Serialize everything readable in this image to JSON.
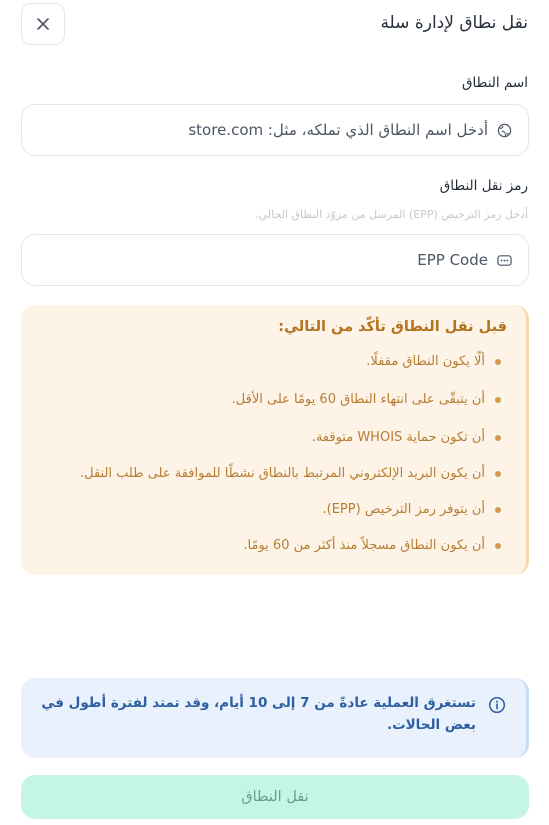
{
  "header": {
    "title": "نقل نطاق لإدارة سلة",
    "close_icon": "close-icon"
  },
  "domain_field": {
    "label": "اسم النطاق",
    "placeholder": "أدخل اسم النطاق الذي تملكه، مثل: store.com",
    "icon": "globe-icon"
  },
  "epp_field": {
    "label": "رمز نقل النطاق",
    "hint": "أدخل رمز الترخيص (EPP) المرسل من مزوّد النطاق الحالي.",
    "placeholder": "EPP Code",
    "icon": "password-dots-icon"
  },
  "requirements": {
    "title": "قبل نقل النطاق تأكّد من التالي:",
    "items": [
      "ألّا يكون النطاق مقفلًا.",
      "أن يتبقّى على انتهاء النطاق 60 يومًا على الأقل.",
      "أن تكون حماية WHOIS متوقفة.",
      "أن يكون البريد الإلكتروني المرتبط بالنطاق نشطًا للموافقة على طلب النقل.",
      "أن يتوفر رمز الترخيص (EPP).",
      "أن يكون النطاق مسجلاً منذ أكثر من 60 يومًا."
    ]
  },
  "info": {
    "icon": "info-icon",
    "text": "تستغرق العملية عادةً من 7 إلى 10 أيام، وقد تمتد لفترة أطول في بعض الحالات."
  },
  "submit": {
    "label": "نقل النطاق"
  },
  "colors": {
    "warning_bg": "#fdf3e7",
    "warning_text": "#b67d33",
    "info_bg": "#e8f1fc",
    "info_text": "#2f5fa3",
    "submit_bg": "#c5f6e5"
  }
}
